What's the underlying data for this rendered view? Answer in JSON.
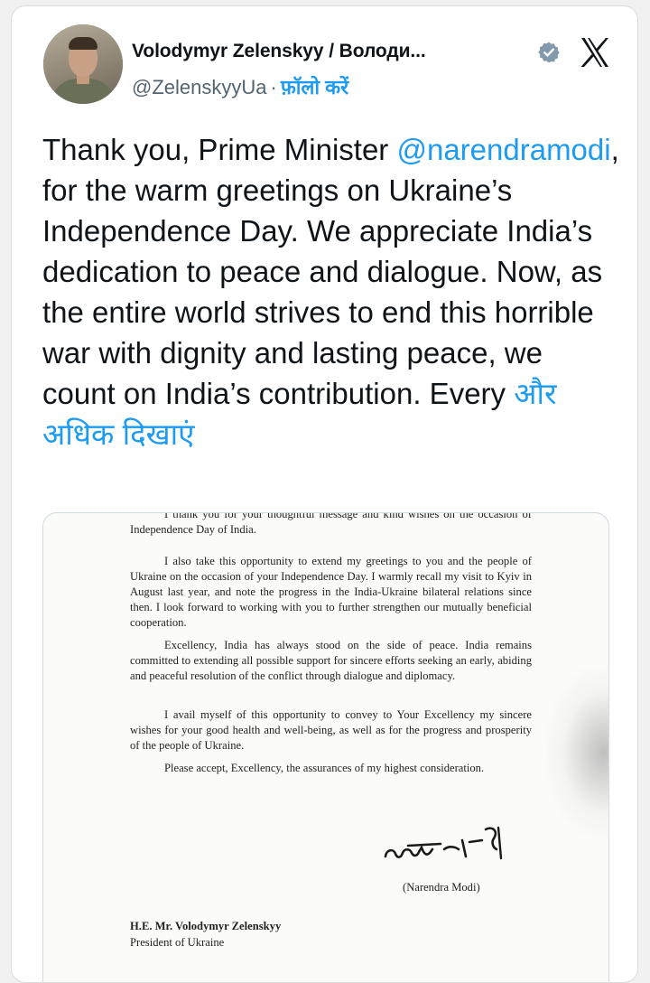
{
  "author": {
    "name": "Volodymyr Zelenskyy / Володи...",
    "handle": "@ZelenskyyUa",
    "separator": "·",
    "follow_label": "फ़ॉलो करें",
    "verified_icon": "verified-badge-icon",
    "avatar": "profile-photo"
  },
  "header": {
    "logo_icon": "x-logo-icon"
  },
  "tweet": {
    "text_before": "Thank you, Prime Minister ",
    "mention": "@narendramodi",
    "text_after": ", for the warm greetings on Ukraine’s Independence Day. We appreciate India’s dedication to peace and dialogue. Now, as the entire world strives to end this horrible war with dignity and lasting peace, we count on India’s contribution. Every ",
    "show_more_label": "और अधिक दिखाएं"
  },
  "letter": {
    "cut_line": "I thank you for your thoughtful message and kind wishes on the occasion of Independence Day of India.",
    "paragraphs": [
      "I also take this opportunity to extend my greetings to you and the people of Ukraine on the occasion of your Independence Day. I warmly recall my visit to Kyiv in August last year, and note the progress in the India-Ukraine bilateral relations since then. I look forward to working with you to further strengthen our mutually beneficial cooperation.",
      "Excellency, India has always stood on the side of peace. India remains committed to extending all possible support for sincere efforts seeking an early, abiding and peaceful resolution of the conflict through dialogue and diplomacy.",
      "I avail myself of this opportunity to convey to Your Excellency my sincere wishes for your good health and well-being, as well as for the progress and prosperity of the people of Ukraine.",
      "Please accept, Excellency, the assurances of my highest consideration."
    ],
    "signatory": "(Narendra Modi)",
    "recipient_name": "H.E. Mr. Volodymyr Zelenskyy",
    "recipient_title": "President of Ukraine"
  },
  "colors": {
    "link": "#1d9bf0",
    "text": "#0f1419",
    "muted": "#536471",
    "verified": "#829aab"
  }
}
